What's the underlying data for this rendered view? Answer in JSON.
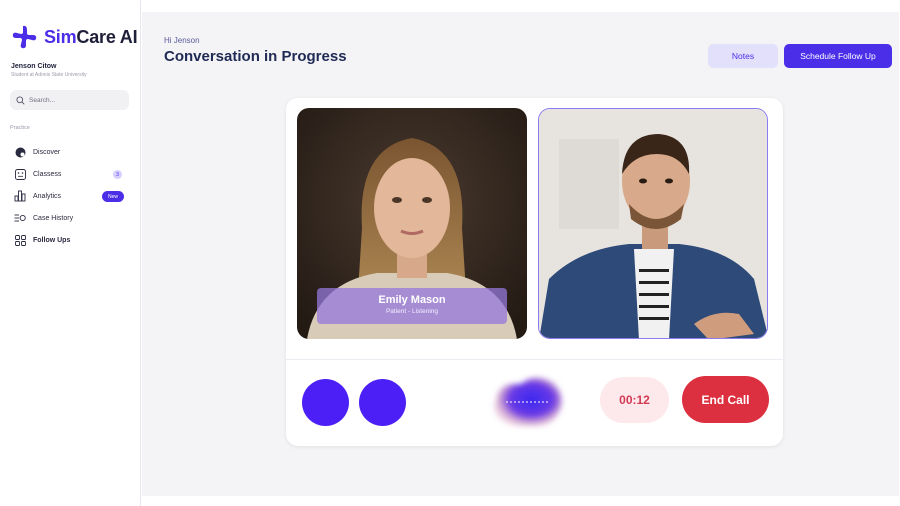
{
  "brand": {
    "name_prefix": "Sim",
    "name_suffix": "Care AI",
    "accent": "#4b2ee8"
  },
  "user": {
    "name": "Jenson Citow",
    "subtitle": "Student at Adonis State University"
  },
  "search": {
    "placeholder": "Search..."
  },
  "sidebar": {
    "section_label": "Practice",
    "items": [
      {
        "label": "Discover",
        "icon": "discover-icon"
      },
      {
        "label": "Classess",
        "icon": "classes-icon",
        "badge": "3"
      },
      {
        "label": "Analytics",
        "icon": "analytics-icon",
        "badge": "New"
      },
      {
        "label": "Case History",
        "icon": "case-history-icon"
      },
      {
        "label": "Follow Ups",
        "icon": "follow-ups-icon"
      }
    ]
  },
  "header": {
    "greeting": "Hi Jenson",
    "title": "Conversation in Progress",
    "notes_label": "Notes",
    "schedule_label": "Schedule Follow Up"
  },
  "call": {
    "patient_name": "Emily Mason",
    "patient_status": "Patient - Listening",
    "timer": "00:12",
    "end_label": "End Call"
  }
}
